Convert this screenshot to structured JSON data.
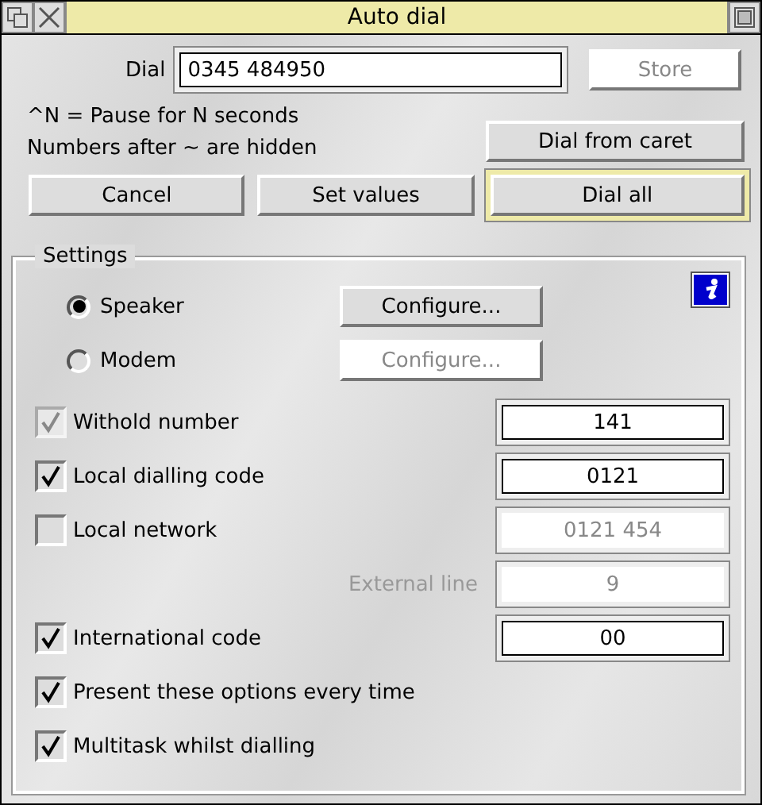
{
  "window": {
    "title": "Auto dial"
  },
  "dial": {
    "label": "Dial",
    "value": "0345 484950"
  },
  "store_button": {
    "label": "Store",
    "disabled": true
  },
  "hints": [
    "^N = Pause for N seconds",
    "Numbers after ~ are hidden"
  ],
  "dial_from_caret_button": {
    "label": "Dial from caret"
  },
  "actions": [
    {
      "label": "Cancel",
      "default": false
    },
    {
      "label": "Set values",
      "default": false
    },
    {
      "label": "Dial all",
      "default": true
    }
  ],
  "settings": {
    "title": "Settings",
    "outputs": [
      {
        "label": "Speaker",
        "selected": true,
        "configure": {
          "label": "Configure...",
          "disabled": false
        }
      },
      {
        "label": "Modem",
        "selected": false,
        "configure": {
          "label": "Configure...",
          "disabled": true
        }
      }
    ],
    "rows": [
      {
        "kind": "check",
        "label": "Withold number",
        "checked": true,
        "disabled": true,
        "field": {
          "value": "141",
          "disabled": false
        }
      },
      {
        "kind": "check",
        "label": "Local dialling code",
        "checked": true,
        "disabled": false,
        "field": {
          "value": "0121",
          "disabled": false
        }
      },
      {
        "kind": "check",
        "label": "Local network",
        "checked": false,
        "disabled": false,
        "field": {
          "value": "0121 454",
          "disabled": true
        }
      },
      {
        "kind": "label",
        "label": "External line",
        "disabled": true,
        "field": {
          "value": "9",
          "disabled": true
        }
      },
      {
        "kind": "check",
        "label": "International code",
        "checked": true,
        "disabled": false,
        "field": {
          "value": "00",
          "disabled": false
        }
      },
      {
        "kind": "check",
        "label": "Present these options every time",
        "checked": true,
        "disabled": false
      },
      {
        "kind": "check",
        "label": "Multitask whilst dialling",
        "checked": true,
        "disabled": false
      }
    ]
  }
}
